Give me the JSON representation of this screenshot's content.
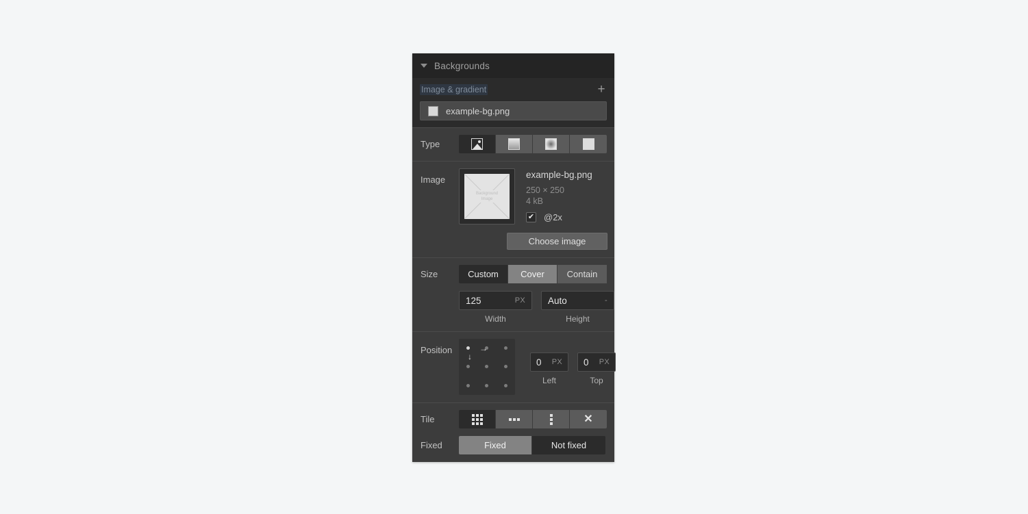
{
  "panel": {
    "title": "Backgrounds",
    "collapse_icon": "caret-down-icon"
  },
  "layers": {
    "group_label": "Image & gradient",
    "add_label": "+",
    "items": [
      {
        "name": "example-bg.png",
        "swatch": "image-swatch"
      }
    ]
  },
  "type": {
    "label": "Type",
    "options": [
      {
        "id": "image",
        "icon": "image-icon",
        "state": "active"
      },
      {
        "id": "linear",
        "icon": "linear-gradient-icon",
        "state": "normal"
      },
      {
        "id": "radial",
        "icon": "radial-gradient-icon",
        "state": "normal"
      },
      {
        "id": "solid",
        "icon": "solid-color-icon",
        "state": "normal"
      }
    ]
  },
  "image": {
    "label": "Image",
    "thumbnail_text": "Background\nImage",
    "thumbnail_line1": "Background",
    "thumbnail_line2": "Image",
    "file_name": "example-bg.png",
    "dimensions": "250 × 250",
    "file_size": "4 kB",
    "retina_label": "@2x",
    "retina_checked": true,
    "check_glyph": "✔",
    "choose_button": "Choose image"
  },
  "size": {
    "label": "Size",
    "options": [
      {
        "label": "Custom",
        "state": "active"
      },
      {
        "label": "Cover",
        "state": "hover"
      },
      {
        "label": "Contain",
        "state": "normal"
      }
    ],
    "width": {
      "value": "125",
      "unit": "PX",
      "caption": "Width"
    },
    "height": {
      "value": "Auto",
      "unit": "-",
      "caption": "Height"
    }
  },
  "position": {
    "label": "Position",
    "selected_cell": "top-left",
    "arrow_right": "→",
    "arrow_down": "↓",
    "left": {
      "value": "0",
      "unit": "PX",
      "caption": "Left"
    },
    "top": {
      "value": "0",
      "unit": "PX",
      "caption": "Top"
    }
  },
  "tile": {
    "label": "Tile",
    "options": [
      {
        "id": "repeat",
        "icon": "tile-grid-icon",
        "state": "active"
      },
      {
        "id": "repeat-x",
        "icon": "tile-repeat-x-icon",
        "state": "normal"
      },
      {
        "id": "repeat-y",
        "icon": "tile-repeat-y-icon",
        "state": "normal"
      },
      {
        "id": "no-repeat",
        "icon": "tile-none-icon",
        "state": "normal",
        "glyph": "✕"
      }
    ]
  },
  "fixed": {
    "label": "Fixed",
    "options": [
      {
        "label": "Fixed",
        "state": "hover"
      },
      {
        "label": "Not fixed",
        "state": "active"
      }
    ]
  },
  "colors": {
    "page_bg": "#f4f6f7",
    "panel_bg": "#3c3c3c",
    "header_bg": "#242424",
    "layers_bg": "#2b2b2b",
    "active_bg": "#2b2b2b",
    "button_bg": "#5b5b5b",
    "hover_bg": "#838383",
    "text": "#c8c8c8",
    "muted_text": "#8e8e8e",
    "selection_blue": "#2f3742"
  }
}
